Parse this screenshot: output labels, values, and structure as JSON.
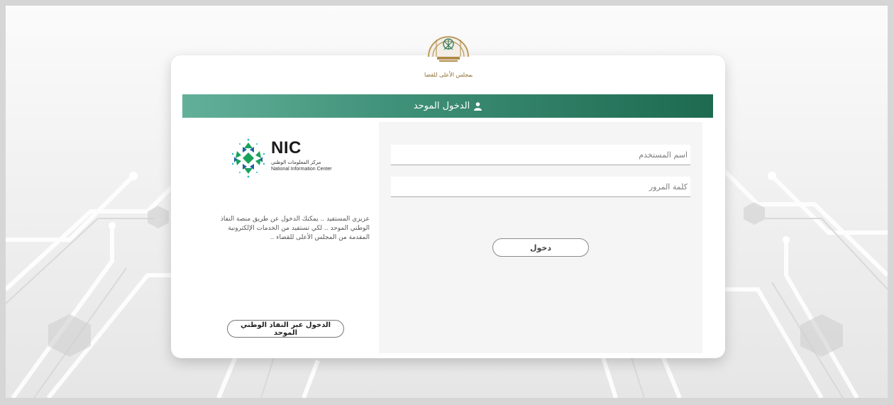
{
  "header": {
    "title": "الدخول الموحد",
    "icon": "user-icon"
  },
  "emblem": {
    "caption": "المجلس الأعلى للقضاء",
    "icon": "justice-emblem-icon"
  },
  "form": {
    "username_placeholder": "اسم المستخدم",
    "password_placeholder": "كلمة المرور",
    "login_label": "دخول"
  },
  "nic": {
    "title": "NIC",
    "arabic_name": "مركز المعلومات الوطني",
    "english_name": "National Information Center",
    "icon": "nic-logo-icon"
  },
  "description": {
    "line1": "عزيزي المستفيد .. يمكنك الدخول عن طريق منصة النفاذ",
    "line2": "الوطني الموحد .. لكي تستفيد من الخدمات الإلكترونية",
    "line3": "المقدمة من المجلس الأعلى للقضاء .."
  },
  "nafath": {
    "label": "الدخول عبر النفاذ الوطني الموحد"
  },
  "colors": {
    "header_start": "#63b099",
    "header_end": "#1d6a50",
    "emblem_gold": "#b08c4a",
    "nic_green": "#17a35a",
    "nic_blue": "#1e5fa3"
  }
}
